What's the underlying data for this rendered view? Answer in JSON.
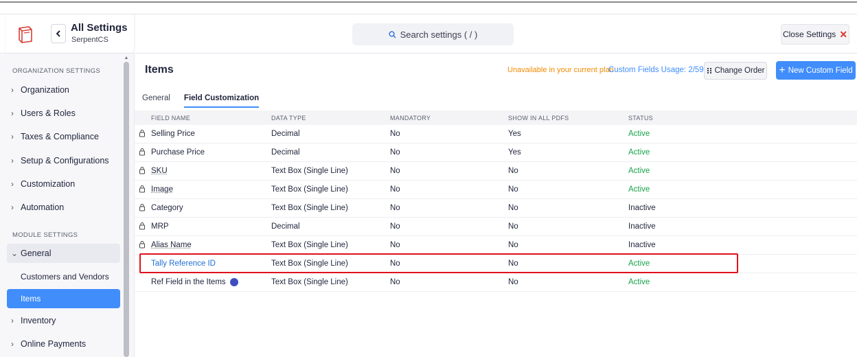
{
  "header": {
    "title": "All Settings",
    "subtitle": "SerpentCS",
    "search_placeholder": "Search settings ( / )",
    "close_label": "Close Settings"
  },
  "sidebar": {
    "org_section": "ORGANIZATION SETTINGS",
    "org_items": [
      "Organization",
      "Users & Roles",
      "Taxes & Compliance",
      "Setup & Configurations",
      "Customization",
      "Automation"
    ],
    "module_section": "MODULE SETTINGS",
    "module_open": "General",
    "module_sub": [
      "Customers and Vendors",
      "Items"
    ],
    "module_items": [
      "Inventory",
      "Online Payments"
    ]
  },
  "main": {
    "title": "Items",
    "unavailable": "Unavailable in your current plan",
    "usage": "Custom Fields Usage: 2/59",
    "change_order": "Change Order",
    "new_field": "New Custom Field",
    "tabs": [
      "General",
      "Field Customization"
    ],
    "columns": [
      "FIELD NAME",
      "DATA TYPE",
      "MANDATORY",
      "SHOW IN ALL PDFS",
      "STATUS"
    ],
    "rows": [
      {
        "name": "Selling Price",
        "type": "Decimal",
        "mandatory": "No",
        "pdf": "Yes",
        "status": "Active"
      },
      {
        "name": "Purchase Price",
        "type": "Decimal",
        "mandatory": "No",
        "pdf": "Yes",
        "status": "Active"
      },
      {
        "name": "SKU",
        "type": "Text Box (Single Line)",
        "mandatory": "No",
        "pdf": "No",
        "status": "Active"
      },
      {
        "name": "Image",
        "type": "Text Box (Single Line)",
        "mandatory": "No",
        "pdf": "No",
        "status": "Active"
      },
      {
        "name": "Category",
        "type": "Text Box (Single Line)",
        "mandatory": "No",
        "pdf": "No",
        "status": "Inactive"
      },
      {
        "name": "MRP",
        "type": "Decimal",
        "mandatory": "No",
        "pdf": "No",
        "status": "Inactive"
      },
      {
        "name": "Alias Name",
        "type": "Text Box (Single Line)",
        "mandatory": "No",
        "pdf": "No",
        "status": "Inactive"
      },
      {
        "name": "Tally Reference ID",
        "type": "Text Box (Single Line)",
        "mandatory": "No",
        "pdf": "No",
        "status": "Active"
      },
      {
        "name": "Ref Field in the Items",
        "type": "Text Box (Single Line)",
        "mandatory": "No",
        "pdf": "No",
        "status": "Active"
      }
    ]
  },
  "colors": {
    "accent": "#408dfb",
    "active_status": "#17a34a",
    "warning": "#f08a00",
    "highlight": "#e0101c"
  }
}
